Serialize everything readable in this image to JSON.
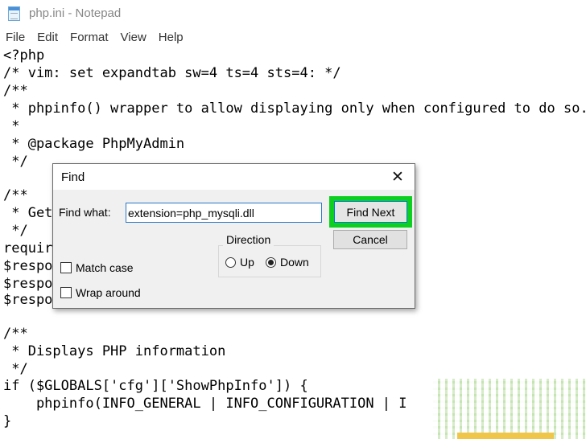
{
  "window": {
    "title": "php.ini - Notepad"
  },
  "menu": [
    "File",
    "Edit",
    "Format",
    "View",
    "Help"
  ],
  "editor": {
    "lines": [
      "<?php",
      "/* vim: set expandtab sw=4 ts=4 sts=4: */",
      "/**",
      " * phpinfo() wrapper to allow displaying only when configured to do so.",
      " *",
      " * @package PhpMyAdmin",
      " */",
      "",
      "/**",
      " * Get",
      " */",
      "requir",
      "$respo",
      "$respo",
      "$respo",
      "",
      "/**",
      " * Displays PHP information",
      " */",
      "if ($GLOBALS['cfg']['ShowPhpInfo']) {",
      "    phpinfo(INFO_GENERAL | INFO_CONFIGURATION | I",
      "}"
    ]
  },
  "find_dialog": {
    "title": "Find",
    "find_label": "Find what:",
    "find_value": "extension=php_mysqli.dll",
    "find_next_label": "Find Next",
    "cancel_label": "Cancel",
    "direction_label": "Direction",
    "up_label": "Up",
    "down_label": "Down",
    "direction_selected": "Down",
    "match_case_label": "Match case",
    "wrap_around_label": "Wrap around",
    "highlight_color": "#0ccf1f"
  }
}
